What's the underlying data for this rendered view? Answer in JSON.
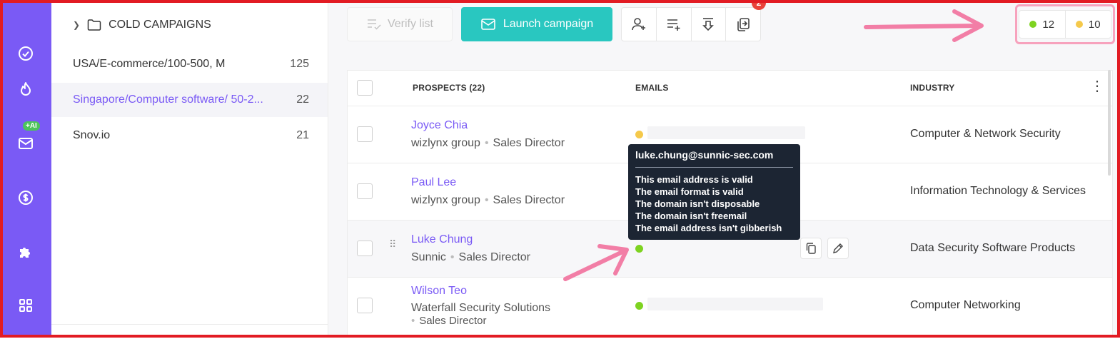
{
  "sidebar": {
    "items": [
      {
        "icon": "check-circle-icon"
      },
      {
        "icon": "flame-icon"
      },
      {
        "icon": "mail-icon",
        "badge": "+AI"
      },
      {
        "icon": "dollar-icon"
      },
      {
        "icon": "puzzle-icon"
      },
      {
        "icon": "apps-grid-icon"
      }
    ],
    "accent": "#7a5af5"
  },
  "lists_panel": {
    "folder_label": "COLD CAMPAIGNS",
    "lists": [
      {
        "name": "USA/E-commerce/100-500, M",
        "count": "125"
      },
      {
        "name": "Singapore/Computer software/ 50-2...",
        "count": "22"
      },
      {
        "name": "Snov.io",
        "count": "21"
      }
    ]
  },
  "toolbar": {
    "verify_label": "Verify list",
    "launch_label": "Launch campaign",
    "launch_color": "#29c7c0",
    "tools": [
      "add-prospect-icon",
      "add-to-list-icon",
      "export-icon",
      "copy-move-icon"
    ],
    "notification_count": "2"
  },
  "status_counts": {
    "valid": "12",
    "unknown": "10",
    "valid_color": "#7ed321",
    "unknown_color": "#f5c94b"
  },
  "table": {
    "headers": {
      "prospects": "PROSPECTS (22)",
      "emails": "EMAILS",
      "industry": "INDUSTRY"
    },
    "rows": [
      {
        "name": "Joyce Chia",
        "company": "wizlynx group",
        "title": "Sales Director",
        "email_status": "unknown",
        "industry": "Computer & Network Security"
      },
      {
        "name": "Paul Lee",
        "company": "wizlynx group",
        "title": "Sales Director",
        "email_status": "valid",
        "industry": "Information Technology & Services"
      },
      {
        "name": "Luke Chung",
        "company": "Sunnic",
        "title": "Sales Director",
        "email_status": "valid",
        "industry": "Data Security Software Products"
      },
      {
        "name": "Wilson Teo",
        "company": "Waterfall Security Solutions",
        "title": "Sales Director",
        "email_status": "valid",
        "industry": "Computer Networking"
      }
    ]
  },
  "tooltip": {
    "email": "luke.chung@sunnic-sec.com",
    "lines": [
      "This email address is valid",
      "The email format is valid",
      "The domain isn't disposable",
      "The domain isn't freemail",
      "The email address isn't gibberish"
    ]
  }
}
